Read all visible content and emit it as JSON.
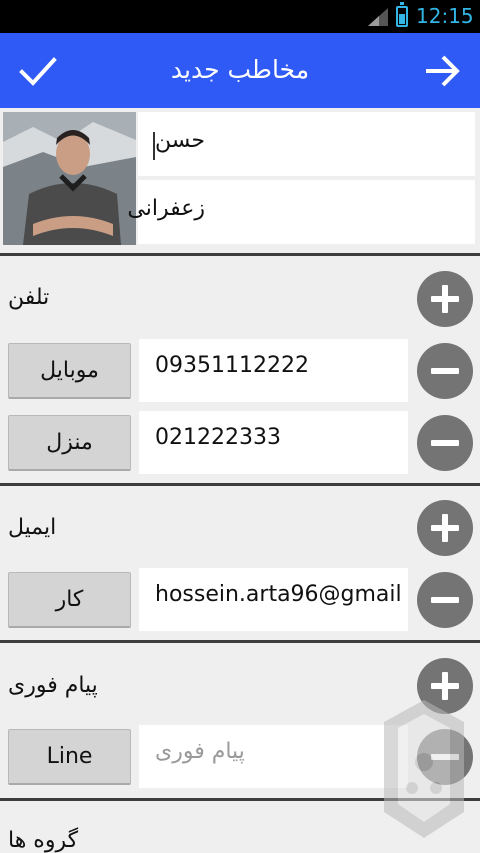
{
  "status_bar": {
    "time": "12:15",
    "accent": "#33b5e5"
  },
  "app_bar": {
    "title": "مخاطب جدید",
    "color": "#2f5af5",
    "left_icon": "check-icon",
    "right_icon": "arrow-right-icon"
  },
  "contact": {
    "first_name": "حسن",
    "last_name": "زعفرانی"
  },
  "phone": {
    "title": "تلفن",
    "entries": [
      {
        "type": "موبایل",
        "value": "09351112222"
      },
      {
        "type": "منزل",
        "value": "021222333"
      }
    ]
  },
  "email": {
    "title": "ایمیل",
    "entries": [
      {
        "type": "کار",
        "value": "hossein.arta96@gmail"
      }
    ]
  },
  "im": {
    "title": "پیام فوری",
    "entries": [
      {
        "type": "Line",
        "placeholder": "پیام فوری"
      }
    ]
  },
  "groups": {
    "title": "گروه ها"
  }
}
